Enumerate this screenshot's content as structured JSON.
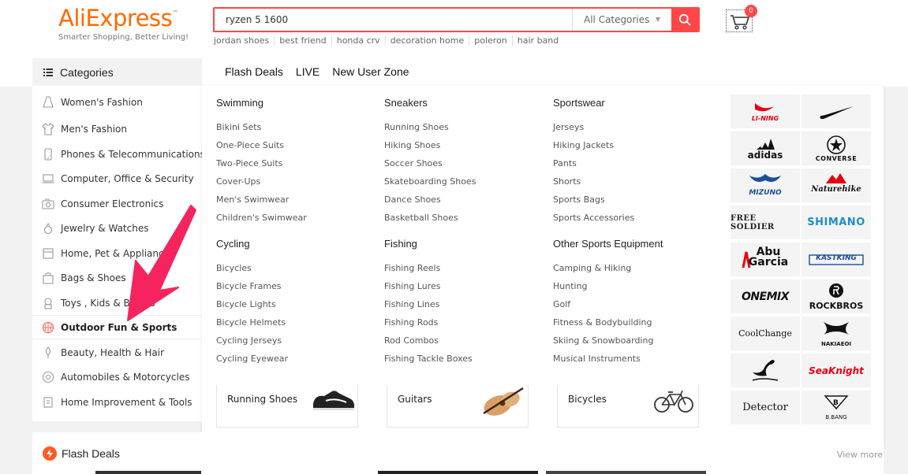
{
  "logo": {
    "brand": "AliExpress",
    "tagline": "Smarter Shopping, Better Living!"
  },
  "search": {
    "value": "ryzen 5 1600",
    "category": "All Categories"
  },
  "hot_searches": [
    "jordan shoes",
    "best friend",
    "honda crv",
    "decoration home",
    "poleron",
    "hair band"
  ],
  "cart": {
    "count": "0"
  },
  "categories_title": "Categories",
  "categories": [
    "Women's Fashion",
    "Men's Fashion",
    "Phones & Telecommunications",
    "Computer, Office & Security",
    "Consumer Electronics",
    "Jewelry & Watches",
    "Home, Pet & Appliances",
    "Bags & Shoes",
    "Toys , Kids & Babies",
    "Outdoor Fun & Sports",
    "Beauty, Health & Hair",
    "Automobiles & Motorcycles",
    "Home Improvement & Tools"
  ],
  "nav": [
    "Flash Deals",
    "LIVE",
    "New User Zone"
  ],
  "mega": {
    "columns": [
      {
        "title": "Swimming",
        "items": [
          "Bikini Sets",
          "One-Piece Suits",
          "Two-Piece Suits",
          "Cover-Ups",
          "Men's Swimwear",
          "Children's Swimwear"
        ]
      },
      {
        "title": "Sneakers",
        "items": [
          "Running Shoes",
          "Hiking Shoes",
          "Soccer Shoes",
          "Skateboarding Shoes",
          "Dance Shoes",
          "Basketball Shoes"
        ]
      },
      {
        "title": "Sportswear",
        "items": [
          "Jerseys",
          "Hiking Jackets",
          "Pants",
          "Shorts",
          "Sports Bags",
          "Sports Accessories"
        ]
      },
      {
        "title": "Cycling",
        "items": [
          "Bicycles",
          "Bicycle Frames",
          "Bicycle Lights",
          "Bicycle Helmets",
          "Cycling Jerseys",
          "Cycling Eyewear"
        ]
      },
      {
        "title": "Fishing",
        "items": [
          "Fishing Reels",
          "Fishing Lures",
          "Fishing Lines",
          "Fishing Rods",
          "Rod Combos",
          "Fishing Tackle Boxes"
        ]
      },
      {
        "title": "Other Sports Equipment",
        "items": [
          "Camping & Hiking",
          "Hunting",
          "Golf",
          "Fitness & Bodybuilding",
          "Skiing & Snowboarding",
          "Musical Instruments"
        ]
      }
    ],
    "promos": [
      "Running Shoes",
      "Guitars",
      "Bicycles"
    ],
    "brands": [
      "LI-NING",
      "NIKE",
      "adidas",
      "CONVERSE",
      "MIZUNO",
      "Naturehike",
      "FREE SOLDIER",
      "SHIMANO",
      "Abu Garcia",
      "KASTKING",
      "ONEMIX",
      "ROCKBROS",
      "CoolChange",
      "NAKIAEOI",
      "",
      "SeaKnight",
      "Detector",
      "B.BANG"
    ]
  },
  "flash_deals": {
    "title": "Flash Deals",
    "view_more": "View more"
  },
  "colors": {
    "brand_orange": "#ff6a00",
    "accent_red": "#ff4747",
    "annotation_pink": "#f5245e"
  }
}
